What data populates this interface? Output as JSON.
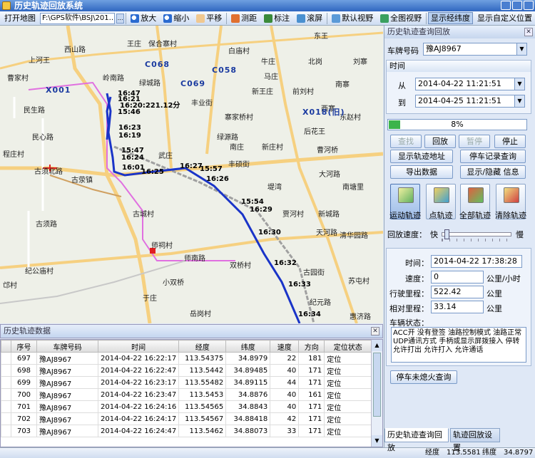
{
  "window": {
    "title": "历史轨迹回放系统"
  },
  "toolbar": {
    "open_map": "打开地图",
    "map_path": "F:\\GPS软件\\BSJ\\201...",
    "zoom_in": "放大",
    "zoom_out": "缩小",
    "pan": "平移",
    "measure": "测距",
    "mark": "标注",
    "roam": "滚屏",
    "default_view": "默认视野",
    "full_view": "全图视野",
    "show_lonlat": "显示经纬度",
    "show_custom_pos": "显示自定义位置"
  },
  "map": {
    "places": [
      "西山路",
      "王庄",
      "保合寨村",
      "白庙村",
      "东王",
      "牛庄",
      "马庄",
      "北岗",
      "刘寨",
      "岭南路",
      "曹家村",
      "绿城路",
      "新王庄",
      "前刘村",
      "南寨",
      "康平村",
      "三王庄",
      "西寨",
      "民生路",
      "丰业街",
      "寨家桥村",
      "X018(旧)",
      "东赵村",
      "后花王",
      "新庄村",
      "南庄",
      "曹河桥",
      "武庄",
      "丰硕街",
      "郭庄村",
      "绿源路",
      "上河王",
      "陇西村",
      "东陈岗",
      "民心路",
      "大河路",
      "古须北路",
      "古荥镇",
      "堤湾",
      "南塘里",
      "古城村",
      "贾河村",
      "新城路",
      "古须路",
      "天河路",
      "清华园路",
      "师祠村",
      "师南路",
      "纪公庙村",
      "双桥村",
      "古园街",
      "苏屯村",
      "小双桥",
      "纪元路",
      "于庄",
      "岳岗村",
      "金沙",
      "惠济路",
      "程庄村",
      "东赵店",
      "邙村"
    ],
    "highways": [
      "C068",
      "C069",
      "C058",
      "X001",
      "X018(旧)"
    ],
    "times": [
      "16:47",
      "16:21",
      "16:20:221.12分",
      "15:46",
      "16:23",
      "16:19",
      "15:47",
      "16:24",
      "16:01",
      "16:25",
      "16:27",
      "15:57",
      "16:26",
      "15:54",
      "16:29",
      "16:30",
      "16:32",
      "16:33",
      "16:34"
    ]
  },
  "grid": {
    "title": "历史轨迹数据",
    "columns": [
      "序号",
      "车牌号码",
      "时间",
      "经度",
      "纬度",
      "速度",
      "方向",
      "定位状态"
    ],
    "rows": [
      [
        "697",
        "豫AJ8967",
        "2014-04-22 16:22:17",
        "113.54375",
        "34.8979",
        "22",
        "181",
        "定位"
      ],
      [
        "698",
        "豫AJ8967",
        "2014-04-22 16:22:47",
        "113.5442",
        "34.89485",
        "40",
        "171",
        "定位"
      ],
      [
        "699",
        "豫AJ8967",
        "2014-04-22 16:23:17",
        "113.55482",
        "34.89115",
        "44",
        "171",
        "定位"
      ],
      [
        "700",
        "豫AJ8967",
        "2014-04-22 16:23:47",
        "113.5453",
        "34.8876",
        "40",
        "161",
        "定位"
      ],
      [
        "701",
        "豫AJ8967",
        "2014-04-22 16:24:16",
        "113.54565",
        "34.8843",
        "40",
        "171",
        "定位"
      ],
      [
        "702",
        "豫AJ8967",
        "2014-04-22 16:24:17",
        "113.54567",
        "34.88418",
        "42",
        "171",
        "定位"
      ],
      [
        "703",
        "豫AJ8967",
        "2014-04-22 16:24:47",
        "113.5462",
        "34.88073",
        "33",
        "171",
        "定位"
      ]
    ]
  },
  "status": {
    "lon_label": "经度",
    "lon": "113.5581",
    "lat_label": "纬度",
    "lat": "34.8797"
  },
  "panel": {
    "title": "历史轨迹查询回放",
    "plate_label": "车牌号码",
    "plate": "豫AJ8967",
    "time_section": "时间",
    "from_label": "从",
    "from": "2014-04-22 11:21:51",
    "to_label": "到",
    "to": "2014-04-25 11:21:51",
    "progress_text": "8%",
    "progress_pct": 8,
    "btn_query": "查找",
    "btn_replay": "回放",
    "btn_pause": "暂停",
    "btn_stop": "停止",
    "btn_show_addr": "显示轨迹地址",
    "btn_park_query": "停车记录查询",
    "btn_export": "导出数据",
    "btn_toggle_info": "显示/隐藏 信息",
    "big_motion": "运动轨迹",
    "big_point": "点轨迹",
    "big_full": "全部轨迹",
    "big_clear": "清除轨迹",
    "speed_label": "回放速度：",
    "speed_fast": "快",
    "speed_slow": "慢",
    "speed_level": 0.07,
    "time_label": "时间：",
    "time_val": "2014-04-22 17:38:28",
    "spd_label": "速度：",
    "spd_val": "0",
    "spd_unit": "公里/小时",
    "mileage_label": "行驶里程：",
    "mileage_val": "522.42",
    "mileage_unit": "公里",
    "rel_label": "相对里程：",
    "rel_val": "33.14",
    "rel_unit": "公里",
    "veh_status_label": "车辆状态：",
    "veh_status": "ACC开 没有登签 油路控制模式 油路正常 UDP通讯方式 手柄或显示屏拨接入 停转 允许打出 允许打入 允许通话",
    "btn_park_off": "停车未熄火查询",
    "tab1": "历史轨迹查询回放",
    "tab2": "轨迹回放设置"
  }
}
